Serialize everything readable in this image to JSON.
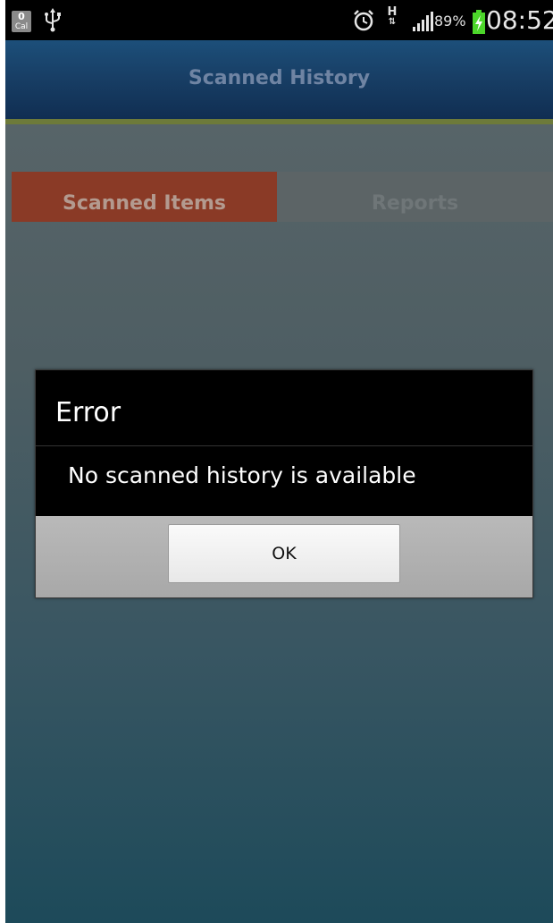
{
  "status_bar": {
    "calendar_count": "0",
    "calendar_label": "Cal",
    "network_type": "H",
    "battery_percent": "89%",
    "time": "08:52",
    "icons": [
      "calendar-icon",
      "usb-icon",
      "alarm-icon",
      "hsdpa-icon",
      "signal-icon",
      "battery-charging-icon"
    ]
  },
  "header": {
    "title": "Scanned History"
  },
  "tabs": [
    {
      "label": "Scanned Items",
      "selected": true
    },
    {
      "label": "Reports",
      "selected": false
    }
  ],
  "dialog": {
    "title": "Error",
    "message": "No scanned history is available",
    "ok_label": "OK"
  },
  "colors": {
    "header_bg": "#183f66",
    "header_accent": "#6d7a3a",
    "tab_selected": "#8a3a26",
    "tab_unselected": "#5c6466",
    "battery_charging": "#4cd62a"
  }
}
